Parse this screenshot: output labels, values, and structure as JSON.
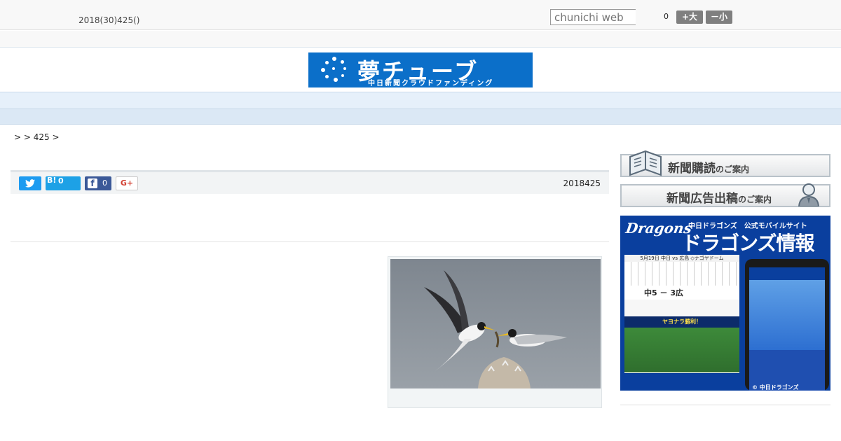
{
  "header": {
    "date": "2018(30)425()",
    "search_placeholder": "chunichi web",
    "font_size_value": "0",
    "font_bigger": "+大",
    "font_smaller": "－小"
  },
  "banner": {
    "title": "夢チューブ",
    "subtitle": "中日新聞クラウドファンディング"
  },
  "nav": {
    "items": [
      "",
      "",
      "",
      "",
      "",
      "",
      "",
      "",
      ""
    ]
  },
  "breadcrumb": ">  > 425 >",
  "article": {
    "share": {
      "hatena_label": "B!",
      "hatena_count": "0",
      "facebook_count": "0",
      "gplus_label": "G+"
    },
    "date": "2018425"
  },
  "sidebar": {
    "subscribe": {
      "main": "新聞購読",
      "suffix": "のご案内"
    },
    "advertise": {
      "main": "新聞広告出稿",
      "suffix": "のご案内"
    },
    "dragons_ad": {
      "logo": "Dragons",
      "tagline": "中日ドラゴンズ　公式モバイルサイト",
      "title": "ドラゴンズ情報",
      "game": "5月19日 中日 vs 広島 ◇ナゴヤドーム",
      "score": "中5 － 3広",
      "result": "ヤヨナラ勝利！",
      "copyright": "© 中日ドラゴンズ"
    }
  },
  "colors": {
    "banner_bg": "#0b6fc9",
    "nav_bg": "#e6f0fa",
    "twitter": "#1d9bf0",
    "hatena": "#1da1e6",
    "facebook": "#3b5998",
    "dragons_bg": "#0a3f9e"
  },
  "icons": {
    "twitter": "twitter-bird-icon",
    "facebook": "facebook-f-icon",
    "newspaper": "newspaper-icon",
    "person": "person-icon"
  }
}
